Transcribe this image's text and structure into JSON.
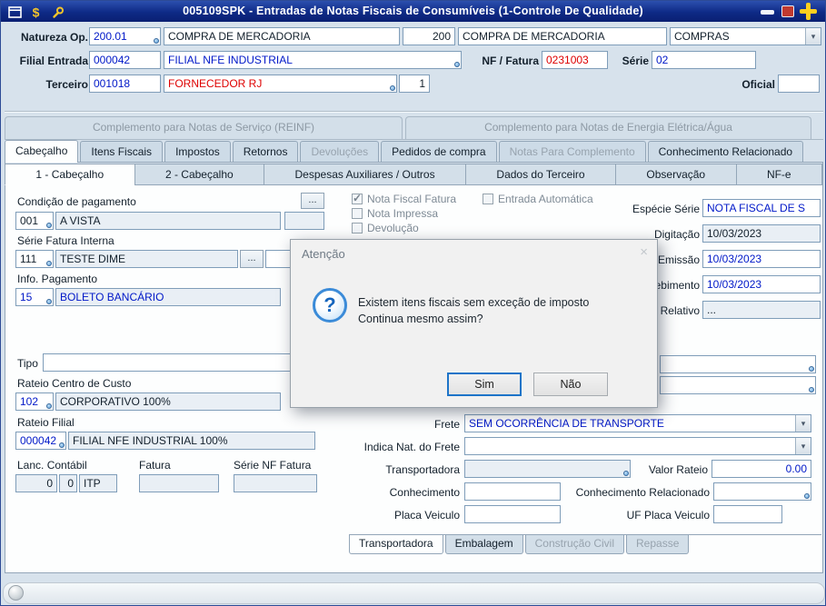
{
  "window": {
    "title": "005109SPK - Entradas de Notas Fiscais de Consumíveis (1-Controle De Qualidade)"
  },
  "header": {
    "natureza_label": "Natureza Op.",
    "natureza_code": "200.01",
    "natureza_desc": "COMPRA DE MERCADORIA",
    "natureza_code2": "200",
    "natureza_desc2": "COMPRA DE MERCADORIA",
    "natureza_combo": "COMPRAS",
    "filial_label": "Filial Entrada",
    "filial_code": "000042",
    "filial_desc": "FILIAL NFE INDUSTRIAL",
    "nf_label": "NF / Fatura",
    "nf_value": "0231003",
    "serie_label": "Série",
    "serie_value": "02",
    "terceiro_label": "Terceiro",
    "terceiro_code": "001018",
    "terceiro_desc": "FORNECEDOR RJ",
    "terceiro_loja": "1",
    "oficial_label": "Oficial",
    "oficial_value": ""
  },
  "complement_tabs": [
    {
      "label": "Complemento para Notas de Serviço (REINF)"
    },
    {
      "label": "Complemento para Notas de Energia Elétrica/Água"
    }
  ],
  "main_tabs": [
    {
      "label": "Cabeçalho"
    },
    {
      "label": "Itens Fiscais"
    },
    {
      "label": "Impostos"
    },
    {
      "label": "Retornos"
    },
    {
      "label": "Devoluções"
    },
    {
      "label": "Pedidos de compra"
    },
    {
      "label": "Notas Para Complemento"
    },
    {
      "label": "Conhecimento Relacionado"
    }
  ],
  "sub_tabs": [
    {
      "label": "1 - Cabeçalho"
    },
    {
      "label": "2 - Cabeçalho"
    },
    {
      "label": "Despesas Auxiliares / Outros"
    },
    {
      "label": "Dados do Terceiro"
    },
    {
      "label": "Observação"
    },
    {
      "label": "NF-e"
    }
  ],
  "left_form": {
    "cond_label": "Condição de pagamento",
    "cond_browse": "...",
    "cond_code": "001",
    "cond_desc": "A VISTA",
    "serie_fatura_label": "Série Fatura Interna",
    "serie_fatura_code": "111",
    "serie_fatura_desc": "TESTE DIME",
    "serie_fatura_browse": "...",
    "info_label": "Info. Pagamento",
    "info_code": "15",
    "info_desc": "BOLETO BANCÁRIO",
    "tipo_label": "Tipo",
    "tipo_value": "",
    "rateio_cc_label": "Rateio Centro de Custo",
    "rateio_cc_code": "102",
    "rateio_cc_desc": "CORPORATIVO 100%",
    "rateio_filial_label": "Rateio Filial",
    "rateio_filial_code": "000042",
    "rateio_filial_desc": "FILIAL NFE INDUSTRIAL 100%",
    "lanc_label": "Lanc. Contábil",
    "fatura_label": "Fatura",
    "serie_nf_label": "Série NF Fatura",
    "lanc_v1": "0",
    "lanc_v2": "0",
    "lanc_v3": "ITP"
  },
  "checks": {
    "nff": "Nota Fiscal Fatura",
    "ea": "Entrada Automática",
    "ni": "Nota Impressa",
    "dev": "Devolução"
  },
  "right_form": {
    "especie_label": "Espécie Série",
    "especie_value": "NOTA FISCAL DE S",
    "digitacao_label": "Digitação",
    "digitacao_value": "10/03/2023",
    "emissao_label": "Emissão",
    "emissao_value": "10/03/2023",
    "recebimento_label": "Recebimento",
    "recebimento_value": "10/03/2023",
    "relativo_label": "Relativo",
    "relativo_value": "...",
    "frete_label": "Frete",
    "frete_value": "SEM OCORRÊNCIA DE TRANSPORTE",
    "indica_label": "Indica Nat. do Frete",
    "indica_value": "",
    "transportadora_label": "Transportadora",
    "transportadora_value": "",
    "valor_rateio_label": "Valor Rateio",
    "valor_rateio_value": "0.00",
    "conhecimento_label": "Conhecimento",
    "conhecimento_value": "",
    "conhecimento_rel_label": "Conhecimento Relacionado",
    "conhecimento_rel_value": "",
    "placa_label": "Placa Veiculo",
    "placa_value": "",
    "uf_placa_label": "UF Placa Veiculo",
    "uf_placa_value": ""
  },
  "bottom_tabs": [
    {
      "label": "Transportadora"
    },
    {
      "label": "Embalagem"
    },
    {
      "label": "Construção Civil"
    },
    {
      "label": "Repasse"
    }
  ],
  "dialog": {
    "title": "Atenção",
    "line1": "Existem itens fiscais sem exceção de imposto",
    "line2": "Continua mesmo assim?",
    "yes": "Sim",
    "no": "Não",
    "close": "×",
    "icon": "?"
  },
  "colors": {
    "titlebar_blue": "#10288a",
    "field_value_blue": "#0018c8",
    "alert_red": "#de0000",
    "close_plus_yellow": "#ffcf1f",
    "maximize_red": "#c03a30"
  }
}
